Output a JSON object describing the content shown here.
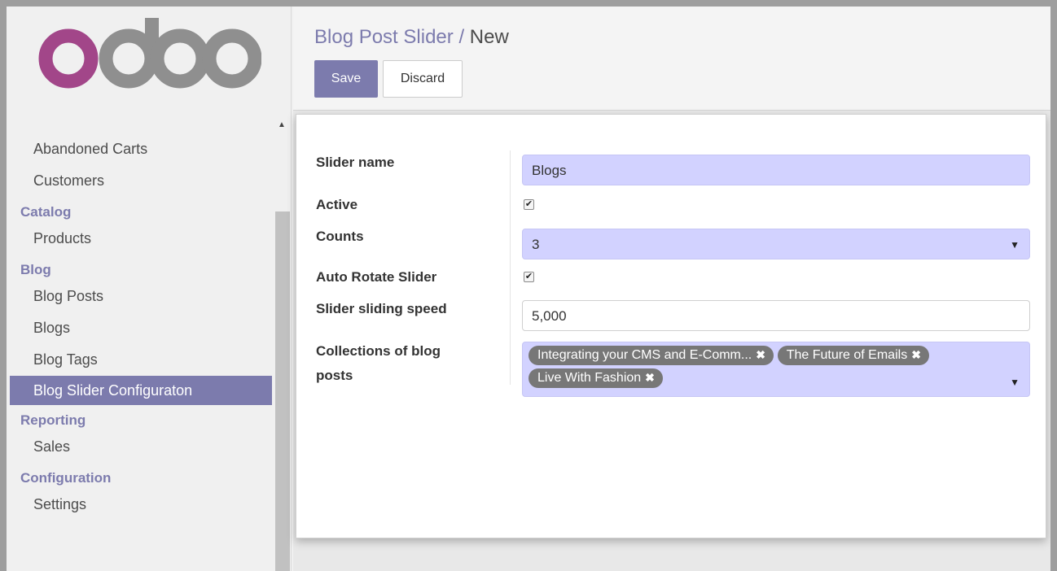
{
  "logo": {
    "text": "odoo",
    "colors": [
      "#a24689",
      "#8f8f8f"
    ]
  },
  "sidebar": {
    "sections": [
      {
        "title": null,
        "items": [
          "Abandoned Carts",
          "Customers"
        ]
      },
      {
        "title": "Catalog",
        "items": [
          "Products"
        ]
      },
      {
        "title": "Blog",
        "items": [
          "Blog Posts",
          "Blogs",
          "Blog Tags",
          "Blog Slider Configuraton"
        ]
      },
      {
        "title": "Reporting",
        "items": [
          "Sales"
        ]
      },
      {
        "title": "Configuration",
        "items": [
          "Settings"
        ]
      }
    ],
    "active_item": "Blog Slider Configuraton"
  },
  "header": {
    "breadcrumb_parent": "Blog Post Slider",
    "breadcrumb_sep": "/",
    "breadcrumb_current": "New",
    "save_label": "Save",
    "discard_label": "Discard"
  },
  "form": {
    "slider_name_label": "Slider name",
    "slider_name_value": "Blogs",
    "active_label": "Active",
    "active_checked": true,
    "counts_label": "Counts",
    "counts_value": "3",
    "auto_rotate_label": "Auto Rotate Slider",
    "auto_rotate_checked": true,
    "speed_label": "Slider sliding speed",
    "speed_value": "5,000",
    "collections_label_1": "Collections of blog",
    "collections_label_2": "posts",
    "collections": [
      "Integrating your CMS and E-Comm...",
      "The Future of Emails",
      "Live With Fashion"
    ]
  },
  "colors": {
    "accent": "#7c7bad",
    "required_field": "#d2d2ff"
  }
}
